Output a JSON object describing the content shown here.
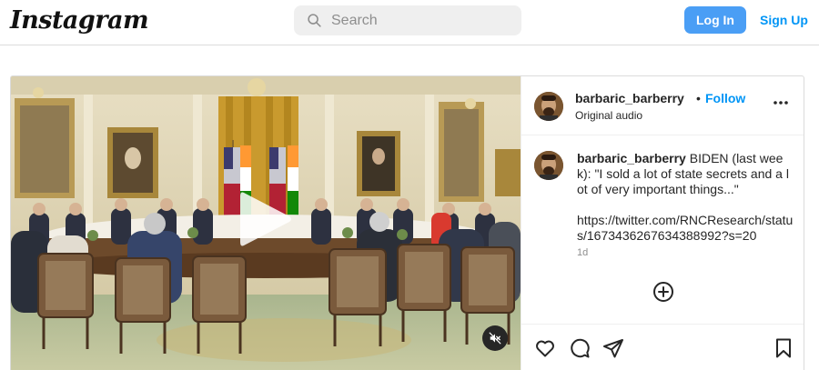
{
  "header": {
    "logo_text": "Instagram",
    "search_placeholder": "Search",
    "login_label": "Log In",
    "signup_label": "Sign Up",
    "accent_color": "#0095f6"
  },
  "post": {
    "username": "barbaric_barberry",
    "separator": "•",
    "follow_label": "Follow",
    "audio_label": "Original audio",
    "caption_username": "barbaric_barberry",
    "caption_text": " BIDEN (last week): \"I sold a lot of state secrets and a lot of very important things...\"\n\nhttps://twitter.com/RNCResearch/status/1673436267634388992?s=20",
    "timestamp": "1d",
    "media": {
      "type": "video",
      "muted": true,
      "play_icon": "play-icon",
      "mute_icon": "muted-speaker-icon"
    },
    "actions": [
      "heart-icon",
      "comment-icon",
      "share-icon",
      "bookmark-icon"
    ],
    "add_comment_icon": "add-circle-icon"
  }
}
